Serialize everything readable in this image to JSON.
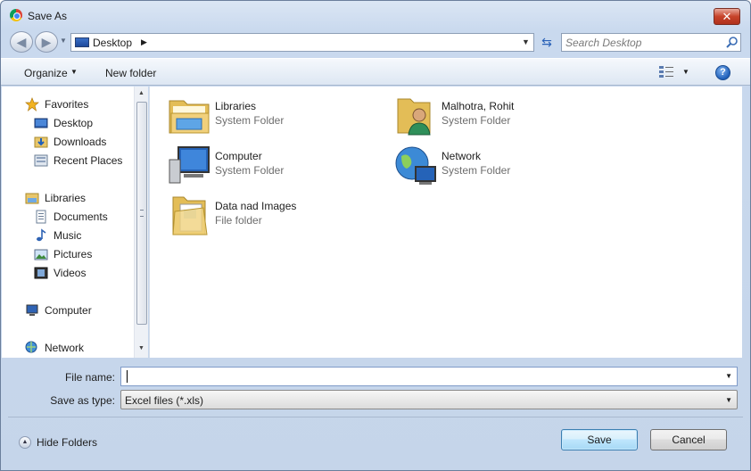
{
  "window": {
    "title": "Save As",
    "close_label": "✕"
  },
  "address": {
    "path": "Desktop"
  },
  "search": {
    "placeholder": "Search Desktop"
  },
  "toolbar": {
    "organize_label": "Organize",
    "new_folder_label": "New folder",
    "help_label": "?"
  },
  "nav": {
    "favorites": "Favorites",
    "desktop": "Desktop",
    "downloads": "Downloads",
    "recent": "Recent Places",
    "libraries": "Libraries",
    "documents": "Documents",
    "music": "Music",
    "pictures": "Pictures",
    "videos": "Videos",
    "computer": "Computer",
    "network": "Network"
  },
  "items": [
    {
      "name": "Libraries",
      "type": "System Folder",
      "icon": "libraries-icon"
    },
    {
      "name": "Malhotra, Rohit",
      "type": "System Folder",
      "icon": "user-folder-icon"
    },
    {
      "name": "Computer",
      "type": "System Folder",
      "icon": "computer-icon"
    },
    {
      "name": "Network",
      "type": "System Folder",
      "icon": "network-icon"
    },
    {
      "name": "Data nad Images",
      "type": "File folder",
      "icon": "folder-icon"
    }
  ],
  "form": {
    "file_name_label": "File name:",
    "file_name_value": "",
    "save_type_label": "Save as type:",
    "save_type_value": "Excel files (*.xls)"
  },
  "footer": {
    "hide_folders_label": "Hide Folders",
    "save_label": "Save",
    "cancel_label": "Cancel"
  },
  "colors": {
    "accent": "#3c7fb1",
    "window_frame": "#c9d9ee",
    "close": "#c7432a"
  }
}
